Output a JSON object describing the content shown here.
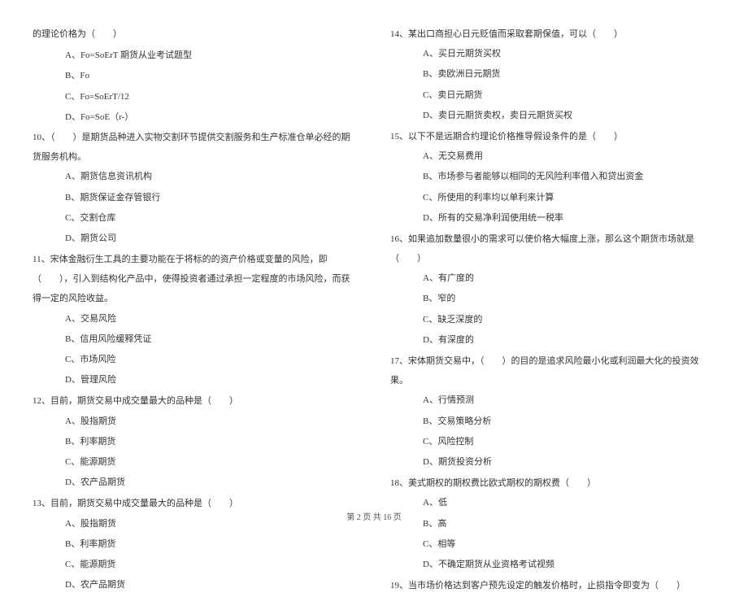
{
  "left_column": {
    "intro": "的理论价格为（　　）",
    "intro_options": [
      "A、Fo=SoErT 期货从业考试题型",
      "B、Fo",
      "C、Fo=SoErT/12",
      "D、Fo=SoE（r-）"
    ],
    "questions": [
      {
        "number": "10、",
        "text": "（　　）是期货品种进入实物交割环节提供交割服务和生产标准仓单必经的期货服务机构。",
        "options": [
          "A、期货信息资讯机构",
          "B、期货保证金存管银行",
          "C、交割仓库",
          "D、期货公司"
        ]
      },
      {
        "number": "11、",
        "text": "宋体金融衍生工具的主要功能在于将标的的资产价格或变量的风险，即（　　），引入到结构化产品中，使得投资者通过承担一定程度的市场风险，而获得一定的风险收益。",
        "options": [
          "A、交易风险",
          "B、信用风险缓释凭证",
          "C、市场风险",
          "D、管理风险"
        ]
      },
      {
        "number": "12、",
        "text": "目前，期货交易中成交量最大的品种是（　　）",
        "options": [
          "A、股指期货",
          "B、利率期货",
          "C、能源期货",
          "D、农产品期货"
        ]
      },
      {
        "number": "13、",
        "text": "目前，期货交易中成交量最大的品种是（　　）",
        "options": [
          "A、股指期货",
          "B、利率期货",
          "C、能源期货",
          "D、农产品期货"
        ]
      }
    ]
  },
  "right_column": {
    "questions": [
      {
        "number": "14、",
        "text": "某出口商担心日元贬值而采取套期保值，可以（　　）",
        "options": [
          "A、买日元期货买权",
          "B、卖欧洲日元期货",
          "C、卖日元期货",
          "D、卖日元期货卖权，卖日元期货买权"
        ]
      },
      {
        "number": "15、",
        "text": "以下不是远期合约理论价格推导假设条件的是（　　）",
        "options": [
          "A、无交易费用",
          "B、市场参与者能够以相同的无风险利率借入和贷出资金",
          "C、所使用的利率均以单利来计算",
          "D、所有的交易净利润使用统一税率"
        ]
      },
      {
        "number": "16、",
        "text": "如果追加数量很小的需求可以使价格大幅度上涨，那么这个期货市场就是（　　）",
        "options": [
          "A、有广度的",
          "B、窄的",
          "C、缺乏深度的",
          "D、有深度的"
        ]
      },
      {
        "number": "17、",
        "text": "宋体期货交易中，（　　）的目的是追求风险最小化或利润最大化的投资效果。",
        "options": [
          "A、行情预测",
          "B、交易策略分析",
          "C、风险控制",
          "D、期货投资分析"
        ]
      },
      {
        "number": "18、",
        "text": "美式期权的期权费比欧式期权的期权费（　　）",
        "options": [
          "A、低",
          "B、高",
          "C、相等",
          "D、不确定期货从业资格考试视频"
        ]
      },
      {
        "number": "19、",
        "text": "当市场价格达到客户预先设定的触发价格时，止损指令即变为（　　）",
        "options": []
      }
    ]
  },
  "footer": "第 2 页 共 16 页"
}
